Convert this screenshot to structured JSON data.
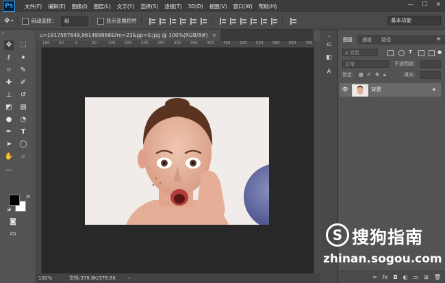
{
  "app": {
    "logo": "Ps"
  },
  "menu": [
    "文件(F)",
    "编辑(E)",
    "图像(I)",
    "图层(L)",
    "文字(Y)",
    "选择(S)",
    "滤镜(T)",
    "3D(D)",
    "视图(V)",
    "窗口(W)",
    "帮助(H)"
  ],
  "window_controls": {
    "minimize": "—",
    "maximize": "☐",
    "close": "✕"
  },
  "options": {
    "auto_select_label": "自动选择：",
    "auto_select_value": "组",
    "show_transform_label": "显示变换控件",
    "workspace": "基本功能"
  },
  "document": {
    "tab_title": "u=1917587649,961499868&fm=23&gp=0.jpg @ 100%(RGB/8#)",
    "tab_close": "×",
    "ruler_ticks": [
      "100",
      "50",
      "0",
      "50",
      "100",
      "150",
      "200",
      "250",
      "300",
      "350",
      "400",
      "450",
      "500",
      "550",
      "600",
      "650",
      "700"
    ],
    "zoom": "100%",
    "doc_size": "文档:378.8K/378.8K",
    "status_arrow": "›"
  },
  "layers_panel": {
    "tabs": [
      "图层",
      "通道",
      "路径"
    ],
    "active_tab": "图层",
    "kind_placeholder": "ρ 类型",
    "blend_mode": "正常",
    "opacity_label": "不透明度:",
    "lock_label": "锁定:",
    "fill_label": "填充:",
    "layers": [
      {
        "name": "背景",
        "visible": true,
        "locked": true
      }
    ]
  },
  "watermark": {
    "logo_glyph": "S",
    "name": "搜狗指南",
    "url": "zhinan.sogou.com"
  },
  "colors": {
    "accent": "#31a8ff",
    "foreground": "#000000",
    "background": "#ffffff"
  }
}
